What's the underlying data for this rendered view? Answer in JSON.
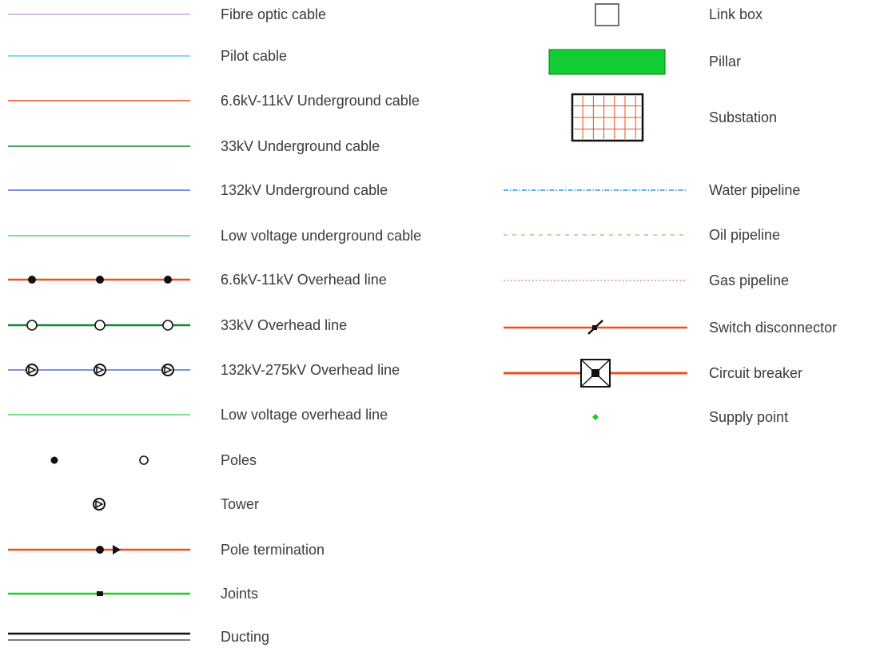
{
  "left_column": [
    {
      "label": "Fibre optic cable",
      "symbol": "line",
      "color": "#c5a3e0"
    },
    {
      "label": "Pilot cable",
      "symbol": "line",
      "color": "#5fd0e0"
    },
    {
      "label": "6.6kV-11kV Underground cable",
      "symbol": "line",
      "color": "#e8501e"
    },
    {
      "label": "33kV Underground cable",
      "symbol": "line",
      "color": "#0f8a2a"
    },
    {
      "label": "132kV Underground cable",
      "symbol": "line",
      "color": "#4f6fd4"
    },
    {
      "label": "Low voltage underground cable",
      "symbol": "line",
      "color": "#4cd86a"
    },
    {
      "label": "6.6kV-11kV Overhead line",
      "symbol": "line-filled-dots",
      "color": "#e8501e"
    },
    {
      "label": "33kV Overhead line",
      "symbol": "line-hollow-circles",
      "color": "#0f8a2a"
    },
    {
      "label": "132kV-275kV Overhead line",
      "symbol": "line-towers",
      "color": "#4f6fd4"
    },
    {
      "label": "Low voltage overhead line",
      "symbol": "line",
      "color": "#4cd86a"
    },
    {
      "label": "Poles",
      "symbol": "poles",
      "color": "#000000"
    },
    {
      "label": "Tower",
      "symbol": "tower",
      "color": "#000000"
    },
    {
      "label": "Pole termination",
      "symbol": "line-termination",
      "color": "#e8501e"
    },
    {
      "label": "Joints",
      "symbol": "line-joint",
      "color": "#22cc22"
    },
    {
      "label": "Ducting",
      "symbol": "double-line",
      "color": "#000000"
    }
  ],
  "right_column": [
    {
      "label": "Link box",
      "symbol": "link-box",
      "color": "#777777"
    },
    {
      "label": "Pillar",
      "symbol": "pillar",
      "color": "#11cc33"
    },
    {
      "label": "Substation",
      "symbol": "substation",
      "color": "#e8501e"
    },
    {
      "label": "Water pipeline",
      "symbol": "dash-dot-line",
      "color": "#2a9ad6"
    },
    {
      "label": "Oil pipeline",
      "symbol": "dashed-line",
      "color": "#d4a070"
    },
    {
      "label": "Gas pipeline",
      "symbol": "dotted-line",
      "color": "#cc66cc"
    },
    {
      "label": "Switch disconnector",
      "symbol": "line-switch",
      "color": "#e8501e"
    },
    {
      "label": "Circuit breaker",
      "symbol": "line-breaker",
      "color": "#e8501e"
    },
    {
      "label": "Supply point",
      "symbol": "supply-point",
      "color": "#22cc22"
    }
  ]
}
